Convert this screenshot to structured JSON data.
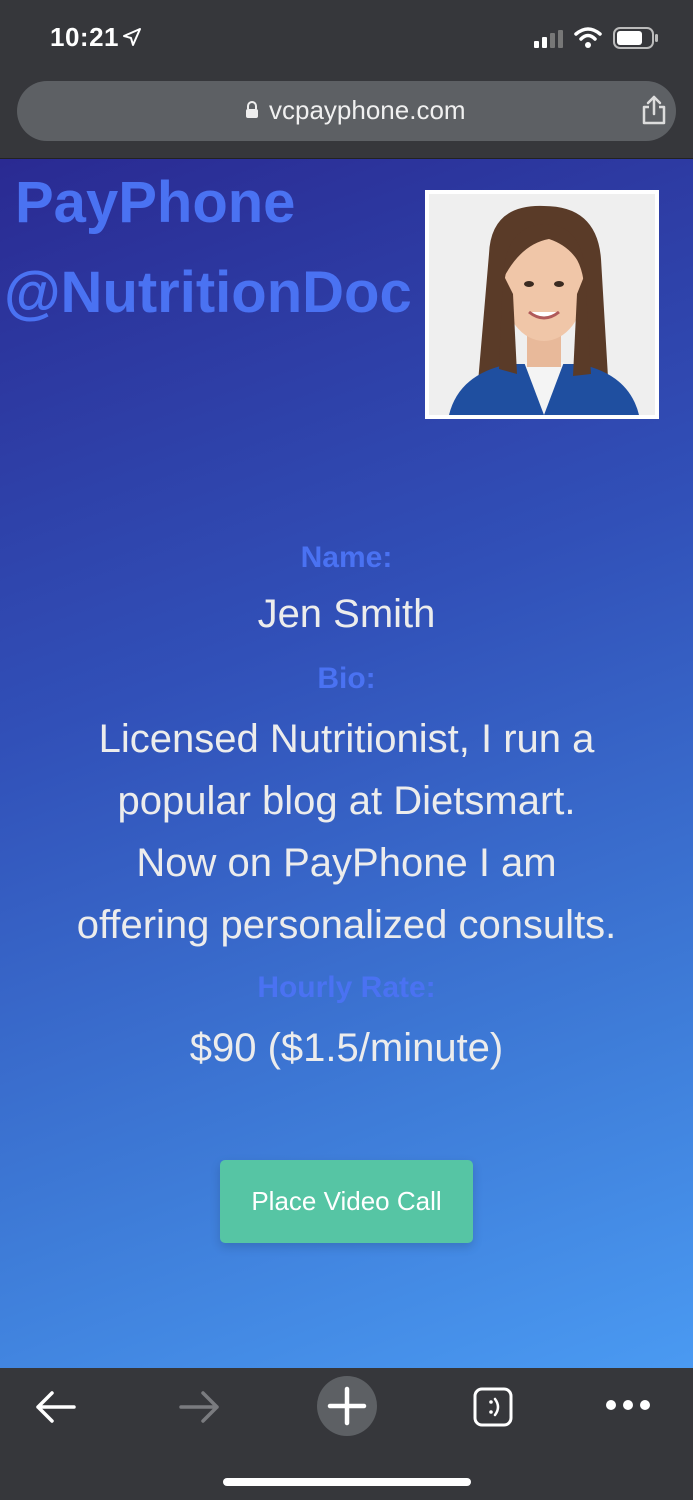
{
  "status_bar": {
    "time": "10:21"
  },
  "browser": {
    "url": "vcpayphone.com"
  },
  "profile": {
    "title_line1": "PayPhone",
    "title_line2": "@NutritionDoc",
    "name_label": "Name:",
    "name": "Jen Smith",
    "bio_label": "Bio:",
    "bio_lines": [
      "Licensed Nutritionist, I run a",
      "popular blog at Dietsmart.",
      "Now on PayPhone I am",
      "offering personalized consults."
    ],
    "rate_label": "Hourly Rate:",
    "rate": "$90 ($1.5/minute)",
    "call_button": "Place Video Call"
  },
  "colors": {
    "accent": "#4a72f2",
    "button": "#56c5a4",
    "chrome": "#36373b"
  },
  "icons": [
    "location-arrow-icon",
    "cellular-signal-icon",
    "wifi-icon",
    "battery-icon",
    "lock-icon",
    "share-icon",
    "back-arrow-icon",
    "forward-arrow-icon",
    "new-tab-plus-icon",
    "tabs-icon",
    "more-icon"
  ]
}
